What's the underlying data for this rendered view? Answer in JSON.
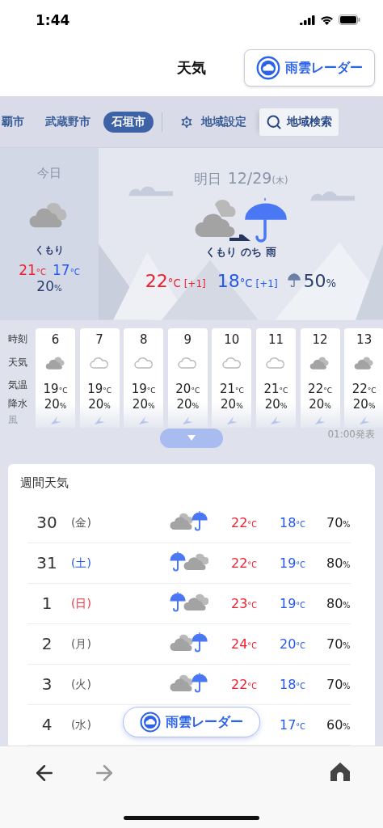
{
  "status_bar": {
    "time": "1:44"
  },
  "header": {
    "title": "天気",
    "radar_button": "雨雲レーダー"
  },
  "city_tabs": [
    {
      "label": "覇市",
      "selected": false
    },
    {
      "label": "武蔵野市",
      "selected": false
    },
    {
      "label": "石垣市",
      "selected": true
    }
  ],
  "settings_button": "地域設定",
  "search_button": "地域検索",
  "today": {
    "label": "今日",
    "condition": "くもり",
    "high": {
      "value": "21",
      "unit": "°C"
    },
    "low": {
      "value": "17",
      "unit": "°C"
    },
    "rain": {
      "value": "20",
      "unit": "%"
    }
  },
  "tomorrow": {
    "label": "明日",
    "date": "12/29",
    "weekday": "(木)",
    "condition": "くもり のち 雨",
    "high": {
      "value": "22",
      "unit": "°C"
    },
    "high_diff": "[+1]",
    "low": {
      "value": "18",
      "unit": "°C"
    },
    "low_diff": "[+1]",
    "rain": {
      "value": "50",
      "unit": "%"
    }
  },
  "hourly": {
    "row_labels": [
      "時刻",
      "天気",
      "気温",
      "降水",
      "風"
    ],
    "issued": "01:00発表",
    "hours": [
      {
        "hour": "6",
        "kind": "cloudy",
        "temp": {
          "value": "19",
          "unit": "°C"
        },
        "rain": {
          "value": "20",
          "unit": "%"
        }
      },
      {
        "hour": "7",
        "kind": "light-cloud",
        "temp": {
          "value": "19",
          "unit": "°C"
        },
        "rain": {
          "value": "20",
          "unit": "%"
        }
      },
      {
        "hour": "8",
        "kind": "light-cloud",
        "temp": {
          "value": "19",
          "unit": "°C"
        },
        "rain": {
          "value": "20",
          "unit": "%"
        }
      },
      {
        "hour": "9",
        "kind": "light-cloud",
        "temp": {
          "value": "20",
          "unit": "°C"
        },
        "rain": {
          "value": "20",
          "unit": "%"
        }
      },
      {
        "hour": "10",
        "kind": "light-cloud",
        "temp": {
          "value": "21",
          "unit": "°C"
        },
        "rain": {
          "value": "20",
          "unit": "%"
        }
      },
      {
        "hour": "11",
        "kind": "light-cloud",
        "temp": {
          "value": "21",
          "unit": "°C"
        },
        "rain": {
          "value": "20",
          "unit": "%"
        }
      },
      {
        "hour": "12",
        "kind": "cloudy",
        "temp": {
          "value": "22",
          "unit": "°C"
        },
        "rain": {
          "value": "20",
          "unit": "%"
        }
      },
      {
        "hour": "13",
        "kind": "cloudy",
        "temp": {
          "value": "22",
          "unit": "°C"
        },
        "rain": {
          "value": "20",
          "unit": "%"
        }
      }
    ]
  },
  "weekly": {
    "title": "週間天気",
    "days": [
      {
        "day": "30",
        "weekday": "(金)",
        "color": "#555555",
        "kind": "cloud-then-rain",
        "high": {
          "value": "22",
          "unit": "°C"
        },
        "low": {
          "value": "18",
          "unit": "°C"
        },
        "rain": {
          "value": "70",
          "unit": "%"
        }
      },
      {
        "day": "31",
        "weekday": "(土)",
        "color": "#2255ee",
        "kind": "rain-then-cloud",
        "high": {
          "value": "22",
          "unit": "°C"
        },
        "low": {
          "value": "19",
          "unit": "°C"
        },
        "rain": {
          "value": "80",
          "unit": "%"
        }
      },
      {
        "day": "1",
        "weekday": "(日)",
        "color": "#f0303c",
        "kind": "rain-then-cloud",
        "high": {
          "value": "23",
          "unit": "°C"
        },
        "low": {
          "value": "19",
          "unit": "°C"
        },
        "rain": {
          "value": "80",
          "unit": "%"
        }
      },
      {
        "day": "2",
        "weekday": "(月)",
        "color": "#555555",
        "kind": "cloud-then-rain",
        "high": {
          "value": "24",
          "unit": "°C"
        },
        "low": {
          "value": "20",
          "unit": "°C"
        },
        "rain": {
          "value": "70",
          "unit": "%"
        }
      },
      {
        "day": "3",
        "weekday": "(火)",
        "color": "#555555",
        "kind": "cloud-then-rain",
        "high": {
          "value": "22",
          "unit": "°C"
        },
        "low": {
          "value": "18",
          "unit": "°C"
        },
        "rain": {
          "value": "70",
          "unit": "%"
        }
      },
      {
        "day": "4",
        "weekday": "(水)",
        "color": "#555555",
        "low": {
          "value": "17",
          "unit": "°C"
        },
        "rain": {
          "value": "60",
          "unit": "%"
        }
      }
    ]
  },
  "floating_radar_button": "雨雲レーダー"
}
